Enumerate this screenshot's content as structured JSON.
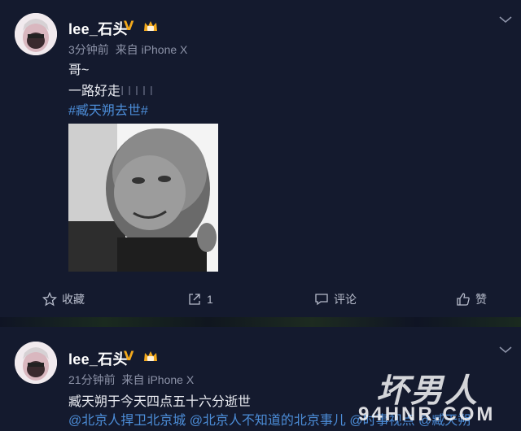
{
  "post1": {
    "username": "lee_石头",
    "time": "3分钟前",
    "source": "来自 iPhone X",
    "lines": [
      "哥~",
      "一路好走"
    ],
    "trailing_marks": "I I I I I",
    "topic": "#臧天朔去世#",
    "photo_icon": "portrait-photo",
    "actions": {
      "favorite": "收藏",
      "repost_count": "1",
      "comment": "评论",
      "like": "赞"
    }
  },
  "post2": {
    "username": "lee_石头",
    "time": "21分钟前",
    "source": "来自 iPhone X",
    "text": "臧天朔于今天四点五十六分逝世",
    "mentions": "@北京人捍卫北京城 @北京人不知道的北京事儿 @时事视点 @臧天朔"
  },
  "watermark": {
    "big": "坏男人",
    "small": "94HNR.COM"
  },
  "colors": {
    "background": "#141a2e",
    "link": "#4c8dd8",
    "verified": "#f3a91c",
    "meta": "#8d93a8"
  }
}
